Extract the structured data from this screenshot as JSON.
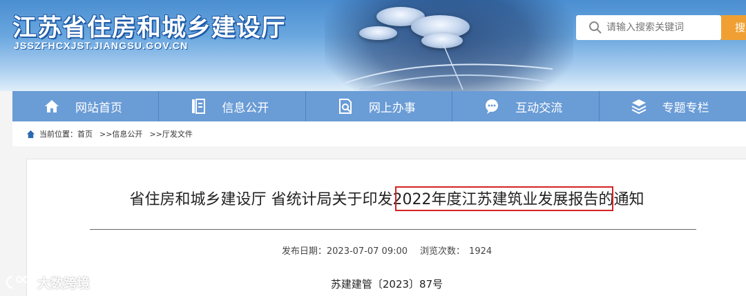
{
  "header": {
    "site_title": "江苏省住房和城乡建设厅",
    "site_url": "JSSZFHCXJST.JIANGSU.GOV.CN",
    "search_placeholder": "请输入搜索关键词",
    "search_button": "搜"
  },
  "nav": {
    "items": [
      {
        "label": "网站首页",
        "icon": "home-icon"
      },
      {
        "label": "信息公开",
        "icon": "document-icon"
      },
      {
        "label": "网上办事",
        "icon": "search-doc-icon"
      },
      {
        "label": "互动交流",
        "icon": "chat-icon"
      },
      {
        "label": "专题专栏",
        "icon": "layers-icon"
      }
    ]
  },
  "breadcrumb": {
    "prefix": "当前位置：",
    "items": [
      "首页",
      ">>信息公开",
      ">>厅发文件"
    ]
  },
  "article": {
    "title": "省住房和城乡建设厅 省统计局关于印发2022年度江苏建筑业发展报告的通知",
    "publish_label": "发布日期：",
    "publish_date": "2023-07-07 09:00",
    "views_label": "浏览次数：",
    "views": "1924",
    "doc_number": "苏建建管〔2023〕87号"
  },
  "watermark": {
    "text": "大数跨境"
  },
  "colors": {
    "nav_bg": "#6a9cd6",
    "search_button": "#f0a033",
    "highlight": "#d42222"
  }
}
